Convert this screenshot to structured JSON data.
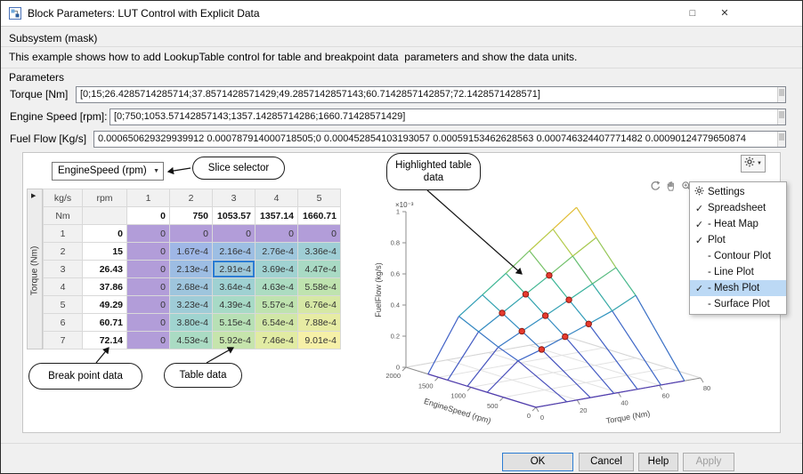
{
  "window": {
    "title": "Block Parameters: LUT Control with Explicit Data",
    "maximize_glyph": "□",
    "close_glyph": "✕"
  },
  "icons": {
    "expand": "▶",
    "caret": "▼",
    "check": "✓"
  },
  "mask": {
    "heading": "Subsystem (mask)",
    "description": "This example shows how to add LookupTable control for table and breakpoint data  parameters and show the data units."
  },
  "parameters_label": "Parameters",
  "fields": [
    {
      "label": "Torque [Nm]",
      "value": "[0;15;26.4285714285714;37.8571428571429;49.2857142857143;60.7142857142857;72.1428571428571]"
    },
    {
      "label": "Engine Speed [rpm]:",
      "value": "[0;750;1053.57142857143;1357.14285714286;1660.71428571429]"
    },
    {
      "label": "Fuel Flow [Kg/s]",
      "value": "0.000650629329939912 0.000787914000718505;0 0.000452854103193057 0.00059153462628563 0.000746324407771482 0.00090124779650874"
    }
  ],
  "slice_selector": {
    "value": "EngineSpeed (rpm)"
  },
  "callouts": {
    "slice": "Slice selector",
    "highlighted": "Highlighted table data",
    "breakpoint": "Break point data",
    "table": "Table data"
  },
  "spreadsheet": {
    "corner_units": "kg/s",
    "col_units": "rpm",
    "row_units": "Nm",
    "axis_label": "Torque (Nm)",
    "col_numbers": [
      "1",
      "2",
      "3",
      "4",
      "5"
    ],
    "col_breakpoints": [
      "0",
      "750",
      "1053.57",
      "1357.14",
      "1660.71"
    ],
    "row_numbers": [
      "1",
      "2",
      "3",
      "4",
      "5",
      "6",
      "7"
    ],
    "row_breakpoints": [
      "0",
      "15",
      "26.43",
      "37.86",
      "49.29",
      "60.71",
      "72.14"
    ],
    "cells": [
      [
        "0",
        "0",
        "0",
        "0",
        "0"
      ],
      [
        "0",
        "1.67e-4",
        "2.16e-4",
        "2.76e-4",
        "3.36e-4"
      ],
      [
        "0",
        "2.13e-4",
        "2.91e-4",
        "3.69e-4",
        "4.47e-4"
      ],
      [
        "0",
        "2.68e-4",
        "3.64e-4",
        "4.63e-4",
        "5.58e-4"
      ],
      [
        "0",
        "3.23e-4",
        "4.39e-4",
        "5.57e-4",
        "6.76e-4"
      ],
      [
        "0",
        "3.80e-4",
        "5.15e-4",
        "6.54e-4",
        "7.88e-4"
      ],
      [
        "0",
        "4.53e-4",
        "5.92e-4",
        "7.46e-4",
        "9.01e-4"
      ]
    ],
    "selected_cell": {
      "row": 2,
      "col": 2
    }
  },
  "chart_data": {
    "type": "mesh",
    "title": "",
    "xlabel": "Torque (Nm)",
    "ylabel": "EngineSpeed (rpm)",
    "zlabel": "FuelFlow (kg/s)",
    "z_exponent_label": "×10⁻³",
    "x": [
      0,
      15,
      26.43,
      37.86,
      49.29,
      60.71,
      72.14
    ],
    "y": [
      0,
      750,
      1053.57,
      1357.14,
      1660.71
    ],
    "z_by_row": [
      [
        0,
        0,
        0,
        0,
        0
      ],
      [
        0,
        0.000167,
        0.000216,
        0.000276,
        0.000336
      ],
      [
        0,
        0.000213,
        0.000291,
        0.000369,
        0.000447
      ],
      [
        0,
        0.000268,
        0.000364,
        0.000463,
        0.000558
      ],
      [
        0,
        0.000323,
        0.000439,
        0.000557,
        0.000676
      ],
      [
        0,
        0.00038,
        0.000515,
        0.000654,
        0.000788
      ],
      [
        0,
        0.000453,
        0.000592,
        0.000746,
        0.000901
      ]
    ],
    "x_ticks": [
      "0",
      "20",
      "40",
      "60",
      "80"
    ],
    "y_ticks": [
      "0",
      "500",
      "1000",
      "1500",
      "2000"
    ],
    "z_ticks": [
      "0",
      "0.2",
      "0.4",
      "0.6",
      "0.8",
      "1"
    ],
    "xlim": [
      0,
      80
    ],
    "ylim": [
      0,
      2000
    ],
    "zlim": [
      0,
      0.001
    ],
    "highlight_points": [
      [
        2,
        1
      ],
      [
        2,
        2
      ],
      [
        2,
        3
      ],
      [
        3,
        1
      ],
      [
        3,
        2
      ],
      [
        3,
        3
      ],
      [
        4,
        1
      ],
      [
        4,
        2
      ],
      [
        4,
        3
      ]
    ],
    "marker_color": "#e63a2e",
    "legend": "none",
    "grid": true
  },
  "plot_toolbar": {
    "icons": [
      "rotate-3d",
      "pan",
      "zoom-in",
      "zoom-out",
      "restore-view"
    ]
  },
  "settings_menu": {
    "items": [
      {
        "label": "Settings",
        "icon": "gear",
        "checked": false,
        "highlighted": false
      },
      {
        "label": "Spreadsheet",
        "checked": true,
        "highlighted": false
      },
      {
        "label": "- Heat Map",
        "checked": true,
        "highlighted": false
      },
      {
        "label": "Plot",
        "checked": true,
        "highlighted": false
      },
      {
        "label": "- Contour Plot",
        "checked": false,
        "highlighted": false
      },
      {
        "label": "- Line Plot",
        "checked": false,
        "highlighted": false
      },
      {
        "label": "- Mesh Plot",
        "checked": true,
        "highlighted": true
      },
      {
        "label": "- Surface Plot",
        "checked": false,
        "highlighted": false
      }
    ]
  },
  "footer": {
    "buttons": [
      {
        "label": "OK",
        "style": "default"
      },
      {
        "label": "Cancel",
        "style": "normal"
      },
      {
        "label": "Help",
        "style": "normal"
      },
      {
        "label": "Apply",
        "style": "disabled"
      }
    ]
  },
  "colors": {
    "accent_blue": "#2b7cd3",
    "menu_highlight": "#bcd9f5",
    "marker_red": "#e63a2e"
  }
}
